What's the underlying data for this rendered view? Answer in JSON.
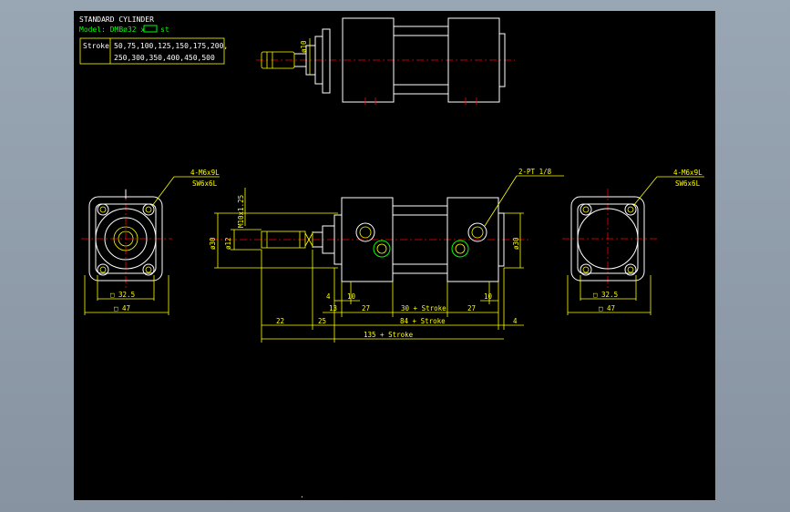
{
  "colors": {
    "background": "#000000",
    "outline": "#ffffff",
    "dimension": "#ffff00",
    "centerline": "#ff0000",
    "port": "#00ff00",
    "title_text": "#ffffff",
    "model_text": "#00ff00"
  },
  "header": {
    "title": "STANDARD CYLINDER",
    "model_prefix": "Model: DMBø32 x",
    "model_suffix": "st",
    "stroke_label": "Stroke",
    "stroke_values_line1": "50,75,100,125,150,175,200,",
    "stroke_values_line2": "250,300,350,400,450,500"
  },
  "top_view": {
    "rod_dia": "ø10"
  },
  "left_end_view": {
    "bolt_label": "4-M6x9L",
    "bolt_label2": "SW6x6L",
    "inner_square": "□ 32.5",
    "outer_square": "□ 47"
  },
  "right_end_view": {
    "bolt_label": "4-M6x9L",
    "bolt_label2": "SW6x6L",
    "inner_square": "□ 32.5",
    "outer_square": "□ 47"
  },
  "side_view": {
    "thread": "M10x1.25",
    "bore_dia": "ø30",
    "body_dia": "ø30",
    "rod_dia": "ø12",
    "port": "2-PT 1/8",
    "dims": {
      "d4a": "4",
      "d10a": "10",
      "d10b": "10",
      "d13": "13",
      "d27a": "27",
      "d30s": "30 + Stroke",
      "d27b": "27",
      "d22": "22",
      "d25": "25",
      "d84s": "84 + Stroke",
      "d4b": "4",
      "d135s": "135 + Stroke"
    }
  },
  "footer_mark": "."
}
